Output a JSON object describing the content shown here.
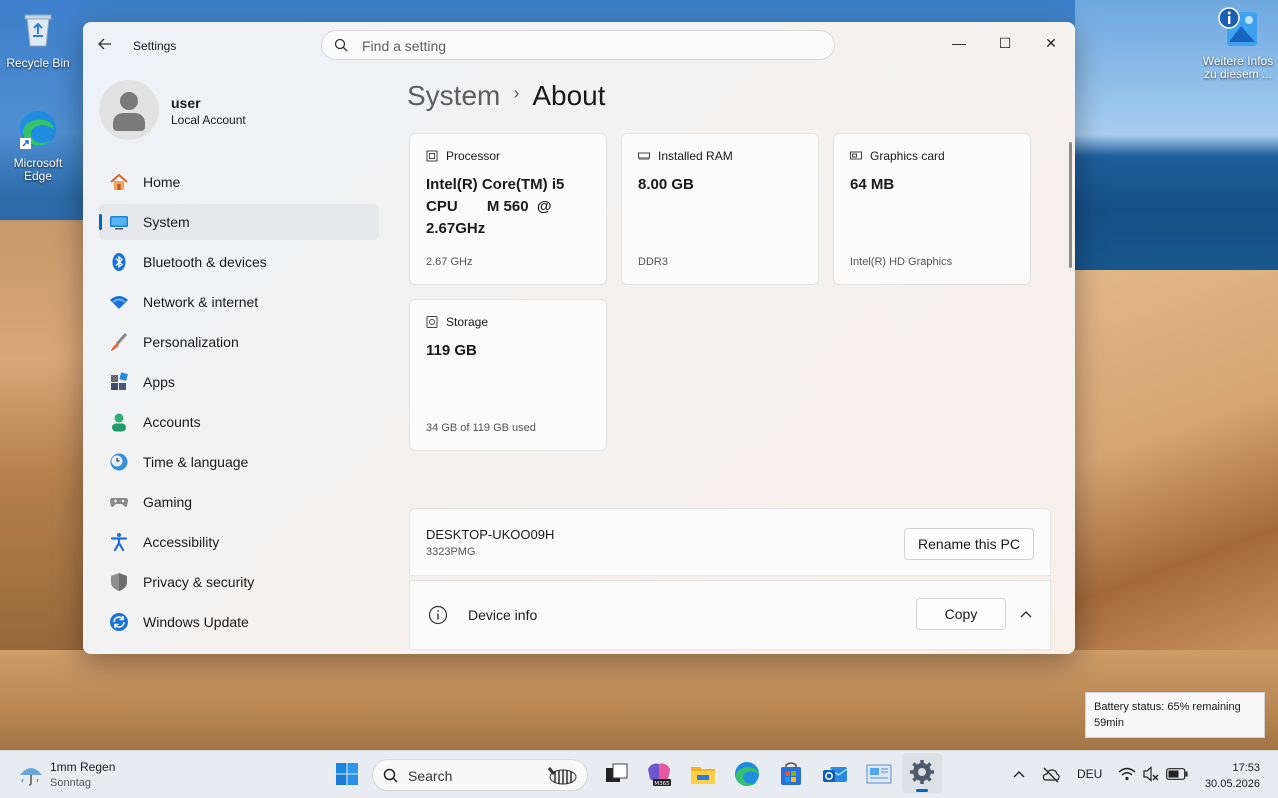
{
  "desktop": {
    "icons": [
      {
        "name": "recycle-bin",
        "label": "Recycle Bin"
      },
      {
        "name": "edge",
        "label": "Microsoft Edge"
      },
      {
        "name": "info",
        "label": "Weitere Infos zu diesem ..."
      }
    ]
  },
  "window": {
    "title": "Settings",
    "search_placeholder": "Find a setting",
    "controls": {
      "minimize": "—",
      "maximize": "☐",
      "close": "✕"
    }
  },
  "user": {
    "name": "user",
    "type": "Local Account"
  },
  "sidebar": {
    "items": [
      {
        "label": "Home",
        "icon": "home-icon"
      },
      {
        "label": "System",
        "icon": "system-icon",
        "active": true
      },
      {
        "label": "Bluetooth & devices",
        "icon": "bluetooth-icon"
      },
      {
        "label": "Network & internet",
        "icon": "wifi-icon"
      },
      {
        "label": "Personalization",
        "icon": "brush-icon"
      },
      {
        "label": "Apps",
        "icon": "apps-icon"
      },
      {
        "label": "Accounts",
        "icon": "person-icon"
      },
      {
        "label": "Time & language",
        "icon": "clock-globe-icon"
      },
      {
        "label": "Gaming",
        "icon": "gamepad-icon"
      },
      {
        "label": "Accessibility",
        "icon": "accessibility-icon"
      },
      {
        "label": "Privacy & security",
        "icon": "shield-icon"
      },
      {
        "label": "Windows Update",
        "icon": "update-icon"
      }
    ]
  },
  "breadcrumb": {
    "parent": "System",
    "separator": "›",
    "current": "About"
  },
  "specs": [
    {
      "title": "Processor",
      "value": "Intel(R) Core(TM) i5\nCPU       M 560  @\n2.67GHz",
      "sub": "2.67 GHz",
      "icon": "cpu-icon"
    },
    {
      "title": "Installed RAM",
      "value": "8.00 GB",
      "sub": "DDR3",
      "icon": "ram-icon"
    },
    {
      "title": "Graphics card",
      "value": "64 MB",
      "sub": "Intel(R) HD Graphics",
      "icon": "gpu-icon"
    },
    {
      "title": "Storage",
      "value": "119 GB",
      "sub": "34 GB of 119 GB used",
      "icon": "storage-icon"
    }
  ],
  "pc": {
    "name": "DESKTOP-UKOO09H",
    "model": "3323PMG",
    "rename_label": "Rename this PC"
  },
  "device_info": {
    "label": "Device info",
    "copy_label": "Copy"
  },
  "toast": {
    "text": "Battery status: 65% remaining 59min"
  },
  "taskbar": {
    "weather": {
      "line1": "1mm Regen",
      "line2": "Sonntag"
    },
    "search_label": "Search",
    "language": "DEU",
    "time": "17:53",
    "date": "30.05.2026"
  },
  "colors": {
    "accent": "#0067c0",
    "window_bg": "#f3f3f3",
    "card_bg": "#fbfbfb"
  }
}
